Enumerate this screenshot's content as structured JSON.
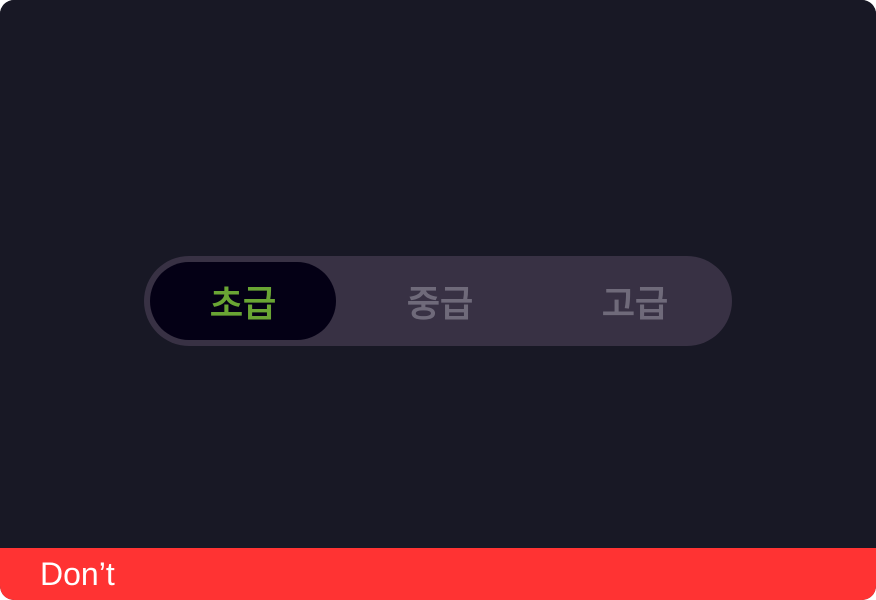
{
  "segmented_control": {
    "options": [
      {
        "label": "초급",
        "selected": true
      },
      {
        "label": "중급",
        "selected": false
      },
      {
        "label": "고급",
        "selected": false
      }
    ]
  },
  "footer": {
    "label": "Don’t"
  },
  "colors": {
    "background": "#181825",
    "track": "#383144",
    "selected_pill": "#040015",
    "selected_text": "#6aa534",
    "unselected_text": "#6f6a7a",
    "footer_bar": "#ff3333"
  }
}
